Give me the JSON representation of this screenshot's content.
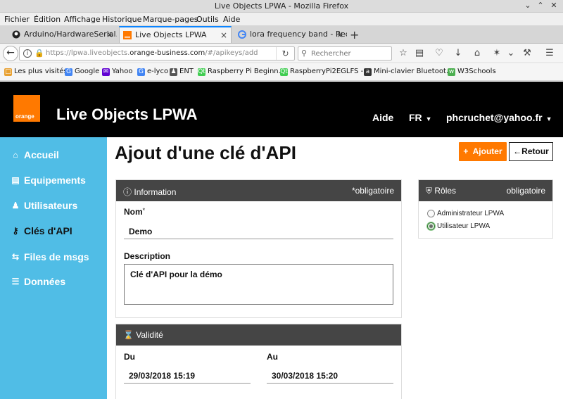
{
  "window": {
    "title": "Live Objects LPWA - Mozilla Firefox"
  },
  "menu": [
    "Fichier",
    "Édition",
    "Affichage",
    "Historique",
    "Marque-pages",
    "Outils",
    "Aide"
  ],
  "tabs": [
    {
      "label": "Arduino/HardwareSerial.h",
      "icon": "github-icon"
    },
    {
      "label": "Live Objects LPWA",
      "icon": "orange-icon"
    },
    {
      "label": "lora frequency band - Reche",
      "icon": "google-icon"
    }
  ],
  "nav": {
    "url_prefix": "https://lpwa.liveobjects.",
    "url_domain": "orange-business.com",
    "url_suffix": "/#/apikeys/add",
    "search_placeholder": "Rechercher"
  },
  "bookmarks": [
    {
      "label": "Les plus visités",
      "icon": "folder-icon",
      "color": "#e8a030"
    },
    {
      "label": "Google",
      "icon": "google-icon",
      "color": "#4285f4"
    },
    {
      "label": "Yahoo",
      "icon": "yahoo-icon",
      "color": "#6001d2"
    },
    {
      "label": "e-lyco",
      "icon": "google-icon",
      "color": "#4285f4"
    },
    {
      "label": "ENT",
      "icon": "person-icon",
      "color": "#555555"
    },
    {
      "label": "Raspberry Pi Beginn...",
      "icon": "qt-icon",
      "color": "#41cd52"
    },
    {
      "label": "RaspberryPi2EGLFS -...",
      "icon": "qt-icon",
      "color": "#41cd52"
    },
    {
      "label": "Mini-clavier Bluetoot...",
      "icon": "amazon-icon",
      "color": "#333333"
    },
    {
      "label": "W3Schools",
      "icon": "w3-icon",
      "color": "#4caf50"
    }
  ],
  "header": {
    "logo_text": "orange",
    "app_title": "Live Objects LPWA",
    "help": "Aide",
    "lang": "FR",
    "user": "phcruchet@yahoo.fr"
  },
  "sidebar": [
    {
      "label": "Accueil",
      "icon": "home-icon",
      "active": false
    },
    {
      "label": "Equipements",
      "icon": "hdd-icon",
      "active": false
    },
    {
      "label": "Utilisateurs",
      "icon": "user-icon",
      "active": false
    },
    {
      "label": "Clés d'API",
      "icon": "key-icon",
      "active": true
    },
    {
      "label": "Files de msgs",
      "icon": "exchange-icon",
      "active": false
    },
    {
      "label": "Données",
      "icon": "database-icon",
      "active": false
    }
  ],
  "page": {
    "title": "Ajout d'une clé d'API",
    "add_button": "Ajouter",
    "back_button": "Retour"
  },
  "information": {
    "title": "Information",
    "required_note": "*obligatoire",
    "name_label": "Nom",
    "name_required_mark": "*",
    "name_value": "Demo",
    "description_label": "Description",
    "description_value": "Clé d'API pour la démo"
  },
  "roles": {
    "title": "Rôles",
    "required_note": "obligatoire",
    "options": [
      {
        "label": "Administrateur LPWA",
        "checked": false
      },
      {
        "label": "Utilisateur LPWA",
        "checked": true
      }
    ]
  },
  "validity": {
    "title": "Validité",
    "from_label": "Du",
    "from_value": "29/03/2018 15:19",
    "to_label": "Au",
    "to_value": "30/03/2018 15:20"
  },
  "colors": {
    "brand_orange": "#ff7900",
    "sidebar_blue": "#50bde6",
    "header_black": "#000000",
    "panel_head": "#454545"
  }
}
